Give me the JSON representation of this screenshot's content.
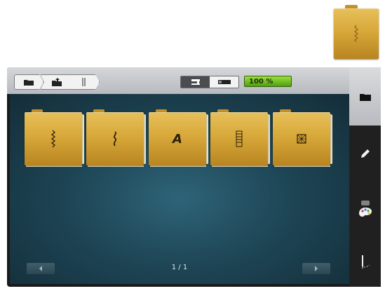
{
  "breadcrumb": {
    "items": [
      {
        "icon": "folder-icon"
      },
      {
        "icon": "folder-upload-icon"
      },
      {
        "icon": "stitch-line-icon"
      }
    ]
  },
  "view_toggle": {
    "left_icon": "sewing-machine-icon",
    "right_icon": "progress-bar-icon",
    "selected": "right"
  },
  "zoom": {
    "label": "100 %"
  },
  "folders": [
    {
      "name": "straight-stitches",
      "icon": "zigzag-icon",
      "glyph": "⦚"
    },
    {
      "name": "decorative-stitches",
      "icon": "serpentine-icon",
      "glyph": "≀"
    },
    {
      "name": "alphabets",
      "icon": "letter-a-icon",
      "glyph": "A"
    },
    {
      "name": "buttonholes",
      "icon": "buttonhole-icon",
      "glyph": "▥"
    },
    {
      "name": "quilt-stitches",
      "icon": "quilt-square-icon",
      "glyph": "⊠"
    }
  ],
  "preview_folder": {
    "icon": "stitch-preview-icon"
  },
  "pager": {
    "label": "1 / 1"
  },
  "sidebar": {
    "items": [
      {
        "name": "files-tab",
        "icon": "folder-icon"
      },
      {
        "name": "edit-tab",
        "icon": "pencil-icon"
      },
      {
        "name": "colors-tab",
        "icon": "palette-icon"
      },
      {
        "name": "needle-tab",
        "icon": "needle-thread-icon"
      }
    ]
  },
  "colors": {
    "folder_gold": "#d8a83a",
    "zoom_green": "#6fbf20",
    "screen_teal": "#1e4656"
  }
}
